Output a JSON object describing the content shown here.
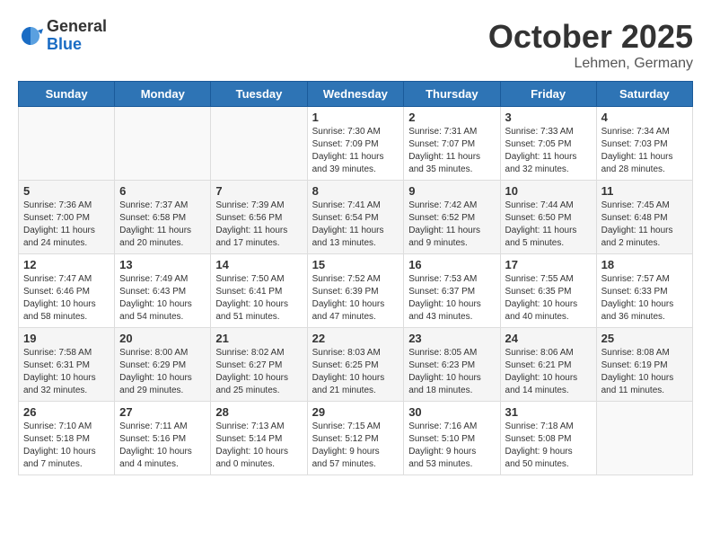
{
  "logo": {
    "general": "General",
    "blue": "Blue"
  },
  "header": {
    "month": "October 2025",
    "location": "Lehmen, Germany"
  },
  "weekdays": [
    "Sunday",
    "Monday",
    "Tuesday",
    "Wednesday",
    "Thursday",
    "Friday",
    "Saturday"
  ],
  "weeks": [
    [
      {
        "day": "",
        "info": ""
      },
      {
        "day": "",
        "info": ""
      },
      {
        "day": "",
        "info": ""
      },
      {
        "day": "1",
        "info": "Sunrise: 7:30 AM\nSunset: 7:09 PM\nDaylight: 11 hours\nand 39 minutes."
      },
      {
        "day": "2",
        "info": "Sunrise: 7:31 AM\nSunset: 7:07 PM\nDaylight: 11 hours\nand 35 minutes."
      },
      {
        "day": "3",
        "info": "Sunrise: 7:33 AM\nSunset: 7:05 PM\nDaylight: 11 hours\nand 32 minutes."
      },
      {
        "day": "4",
        "info": "Sunrise: 7:34 AM\nSunset: 7:03 PM\nDaylight: 11 hours\nand 28 minutes."
      }
    ],
    [
      {
        "day": "5",
        "info": "Sunrise: 7:36 AM\nSunset: 7:00 PM\nDaylight: 11 hours\nand 24 minutes."
      },
      {
        "day": "6",
        "info": "Sunrise: 7:37 AM\nSunset: 6:58 PM\nDaylight: 11 hours\nand 20 minutes."
      },
      {
        "day": "7",
        "info": "Sunrise: 7:39 AM\nSunset: 6:56 PM\nDaylight: 11 hours\nand 17 minutes."
      },
      {
        "day": "8",
        "info": "Sunrise: 7:41 AM\nSunset: 6:54 PM\nDaylight: 11 hours\nand 13 minutes."
      },
      {
        "day": "9",
        "info": "Sunrise: 7:42 AM\nSunset: 6:52 PM\nDaylight: 11 hours\nand 9 minutes."
      },
      {
        "day": "10",
        "info": "Sunrise: 7:44 AM\nSunset: 6:50 PM\nDaylight: 11 hours\nand 5 minutes."
      },
      {
        "day": "11",
        "info": "Sunrise: 7:45 AM\nSunset: 6:48 PM\nDaylight: 11 hours\nand 2 minutes."
      }
    ],
    [
      {
        "day": "12",
        "info": "Sunrise: 7:47 AM\nSunset: 6:46 PM\nDaylight: 10 hours\nand 58 minutes."
      },
      {
        "day": "13",
        "info": "Sunrise: 7:49 AM\nSunset: 6:43 PM\nDaylight: 10 hours\nand 54 minutes."
      },
      {
        "day": "14",
        "info": "Sunrise: 7:50 AM\nSunset: 6:41 PM\nDaylight: 10 hours\nand 51 minutes."
      },
      {
        "day": "15",
        "info": "Sunrise: 7:52 AM\nSunset: 6:39 PM\nDaylight: 10 hours\nand 47 minutes."
      },
      {
        "day": "16",
        "info": "Sunrise: 7:53 AM\nSunset: 6:37 PM\nDaylight: 10 hours\nand 43 minutes."
      },
      {
        "day": "17",
        "info": "Sunrise: 7:55 AM\nSunset: 6:35 PM\nDaylight: 10 hours\nand 40 minutes."
      },
      {
        "day": "18",
        "info": "Sunrise: 7:57 AM\nSunset: 6:33 PM\nDaylight: 10 hours\nand 36 minutes."
      }
    ],
    [
      {
        "day": "19",
        "info": "Sunrise: 7:58 AM\nSunset: 6:31 PM\nDaylight: 10 hours\nand 32 minutes."
      },
      {
        "day": "20",
        "info": "Sunrise: 8:00 AM\nSunset: 6:29 PM\nDaylight: 10 hours\nand 29 minutes."
      },
      {
        "day": "21",
        "info": "Sunrise: 8:02 AM\nSunset: 6:27 PM\nDaylight: 10 hours\nand 25 minutes."
      },
      {
        "day": "22",
        "info": "Sunrise: 8:03 AM\nSunset: 6:25 PM\nDaylight: 10 hours\nand 21 minutes."
      },
      {
        "day": "23",
        "info": "Sunrise: 8:05 AM\nSunset: 6:23 PM\nDaylight: 10 hours\nand 18 minutes."
      },
      {
        "day": "24",
        "info": "Sunrise: 8:06 AM\nSunset: 6:21 PM\nDaylight: 10 hours\nand 14 minutes."
      },
      {
        "day": "25",
        "info": "Sunrise: 8:08 AM\nSunset: 6:19 PM\nDaylight: 10 hours\nand 11 minutes."
      }
    ],
    [
      {
        "day": "26",
        "info": "Sunrise: 7:10 AM\nSunset: 5:18 PM\nDaylight: 10 hours\nand 7 minutes."
      },
      {
        "day": "27",
        "info": "Sunrise: 7:11 AM\nSunset: 5:16 PM\nDaylight: 10 hours\nand 4 minutes."
      },
      {
        "day": "28",
        "info": "Sunrise: 7:13 AM\nSunset: 5:14 PM\nDaylight: 10 hours\nand 0 minutes."
      },
      {
        "day": "29",
        "info": "Sunrise: 7:15 AM\nSunset: 5:12 PM\nDaylight: 9 hours\nand 57 minutes."
      },
      {
        "day": "30",
        "info": "Sunrise: 7:16 AM\nSunset: 5:10 PM\nDaylight: 9 hours\nand 53 minutes."
      },
      {
        "day": "31",
        "info": "Sunrise: 7:18 AM\nSunset: 5:08 PM\nDaylight: 9 hours\nand 50 minutes."
      },
      {
        "day": "",
        "info": ""
      }
    ]
  ]
}
